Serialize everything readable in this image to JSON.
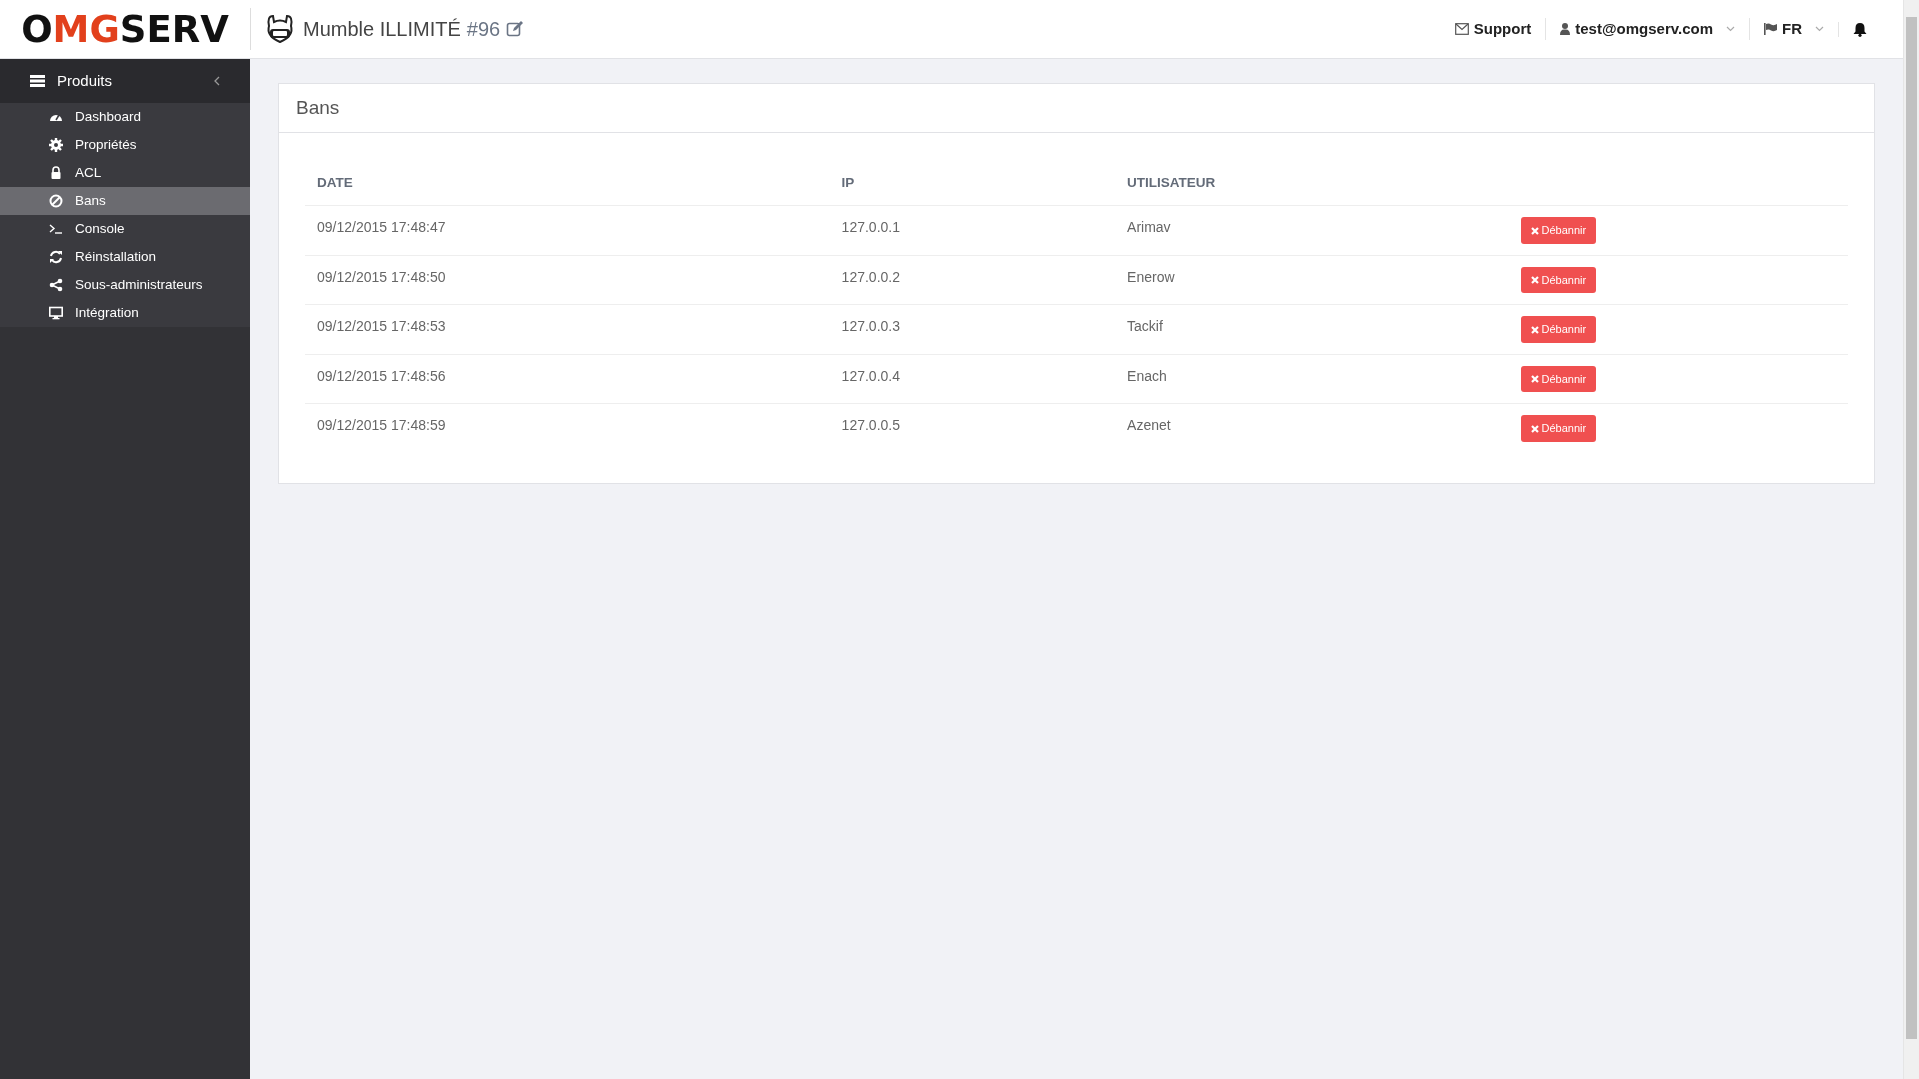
{
  "header": {
    "logo": [
      {
        "text": "O",
        "color": "#111111"
      },
      {
        "text": "MG",
        "color": "#e2401c"
      },
      {
        "text": "SERV",
        "color": "#111111"
      }
    ],
    "server_name": "Mumble ILLIMITÉ",
    "server_id": "#96",
    "nav": [
      {
        "kind": "support",
        "label": "Support"
      },
      {
        "kind": "user",
        "label": "test@omgserv.com"
      },
      {
        "kind": "language",
        "label": "FR"
      },
      {
        "kind": "notifications"
      }
    ]
  },
  "sidebar": {
    "section": "Produits",
    "expanded": true,
    "items": [
      {
        "label": "Dashboard",
        "selected": false
      },
      {
        "label": "Propriétés",
        "selected": false
      },
      {
        "label": "ACL",
        "selected": false
      },
      {
        "label": "Bans",
        "selected": true
      },
      {
        "label": "Console",
        "selected": false
      },
      {
        "label": "Réinstallation",
        "selected": false
      },
      {
        "label": "Sous-administrateurs",
        "selected": false
      },
      {
        "label": "Intégration",
        "selected": false
      }
    ]
  },
  "panel": {
    "title": "Bans",
    "table": {
      "columns": [
        "DATE",
        "IP",
        "UTILISATEUR"
      ],
      "rows": [
        {
          "date": "09/12/2015 17:48:47",
          "ip": "127.0.0.1",
          "user": "Arimav",
          "action": "Débannir"
        },
        {
          "date": "09/12/2015 17:48:50",
          "ip": "127.0.0.2",
          "user": "Enerow",
          "action": "Débannir"
        },
        {
          "date": "09/12/2015 17:48:53",
          "ip": "127.0.0.3",
          "user": "Tackif",
          "action": "Débannir"
        },
        {
          "date": "09/12/2015 17:48:56",
          "ip": "127.0.0.4",
          "user": "Enach",
          "action": "Débannir"
        },
        {
          "date": "09/12/2015 17:48:59",
          "ip": "127.0.0.5",
          "user": "Azenet",
          "action": "Débannir"
        }
      ]
    }
  }
}
